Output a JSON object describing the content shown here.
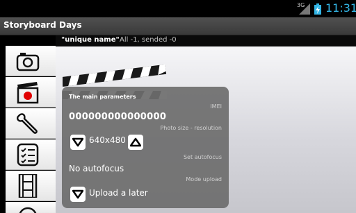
{
  "status_bar": {
    "network": "3G",
    "time": "11:31"
  },
  "app": {
    "title": "Storyboard Days"
  },
  "info_bar": {
    "name": "\"unique name\"",
    "counts": "All -1, sended -0"
  },
  "sidebar": {
    "buttons": [
      {
        "icon": "camera-icon"
      },
      {
        "icon": "record-icon"
      },
      {
        "icon": "wrench-icon"
      },
      {
        "icon": "checklist-icon"
      },
      {
        "icon": "film-strip-icon"
      }
    ]
  },
  "params_panel": {
    "heading": "The main parameters",
    "imei_label": "IMEI",
    "imei_value": "000000000000000",
    "photo_size_label": "Photo size - resolution",
    "photo_size_value": "640x480",
    "autofocus_label": "Set autofocus",
    "autofocus_value": "No autofocus",
    "upload_label": "Mode upload",
    "upload_value": "Upload a later"
  },
  "colors": {
    "clock": "#33b5e5",
    "record": "#e00000",
    "overlay": "#6e6e6e"
  }
}
